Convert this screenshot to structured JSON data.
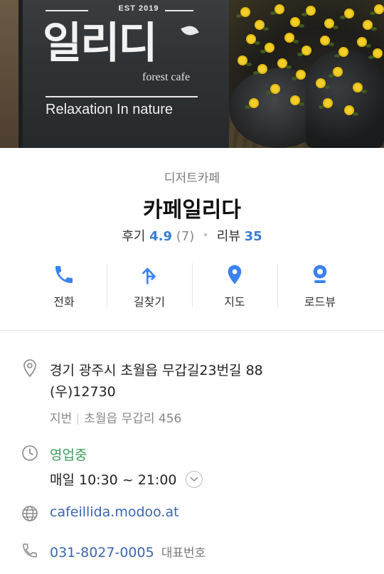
{
  "hero": {
    "est_text": "EST 2019",
    "logo_text": "일리디",
    "tagline": "forest cafe",
    "slogan": "Relaxation In nature"
  },
  "place": {
    "category": "디저트카페",
    "name": "카페일리다",
    "review_label": "후기",
    "rating": "4.9",
    "rating_count": "(7)",
    "blog_review_label": "리뷰",
    "blog_review_count": "35"
  },
  "actions": [
    {
      "label": "전화",
      "icon": "phone-icon"
    },
    {
      "label": "길찾기",
      "icon": "directions-icon"
    },
    {
      "label": "지도",
      "icon": "map-pin-icon"
    },
    {
      "label": "로드뷰",
      "icon": "roadview-icon"
    }
  ],
  "info": {
    "address_line1": "경기 광주시 초월읍 무갑길23번길 88",
    "address_line2": "(우)12730",
    "jibun_label": "지번",
    "jibun_address": "초월읍 무갑리 456",
    "status": "영업중",
    "hours": "매일 10:30 ~ 21:00",
    "website": "cafeillida.modoo.at",
    "phone": "031-8027-0005",
    "phone_label": "대표번호"
  },
  "colors": {
    "accent_blue": "#3a7bd5",
    "link_blue": "#3a66b0",
    "open_green": "#3e9a5e",
    "icon_blue": "#3b82f0"
  }
}
